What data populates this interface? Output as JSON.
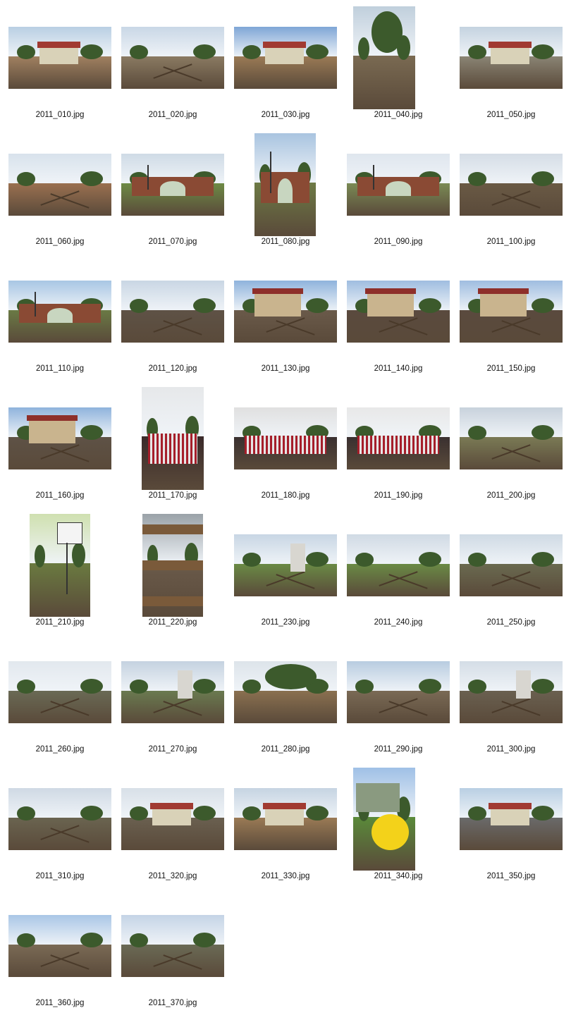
{
  "files": [
    "2011_010.jpg",
    "2011_020.jpg",
    "2011_030.jpg",
    "2011_040.jpg",
    "2011_050.jpg",
    "2011_060.jpg",
    "2011_070.jpg",
    "2011_080.jpg",
    "2011_090.jpg",
    "2011_100.jpg",
    "2011_110.jpg",
    "2011_120.jpg",
    "2011_130.jpg",
    "2011_140.jpg",
    "2011_150.jpg",
    "2011_160.jpg",
    "2011_170.jpg",
    "2011_180.jpg",
    "2011_190.jpg",
    "2011_200.jpg",
    "2011_210.jpg",
    "2011_220.jpg",
    "2011_230.jpg",
    "2011_240.jpg",
    "2011_250.jpg",
    "2011_260.jpg",
    "2011_270.jpg",
    "2011_280.jpg",
    "2011_290.jpg",
    "2011_300.jpg",
    "2011_310.jpg",
    "2011_320.jpg",
    "2011_330.jpg",
    "2011_340.jpg",
    "2011_350.jpg",
    "2011_360.jpg",
    "2011_370.jpg"
  ],
  "colors": {
    "background": "#ffffff",
    "label_text": "#111111"
  }
}
